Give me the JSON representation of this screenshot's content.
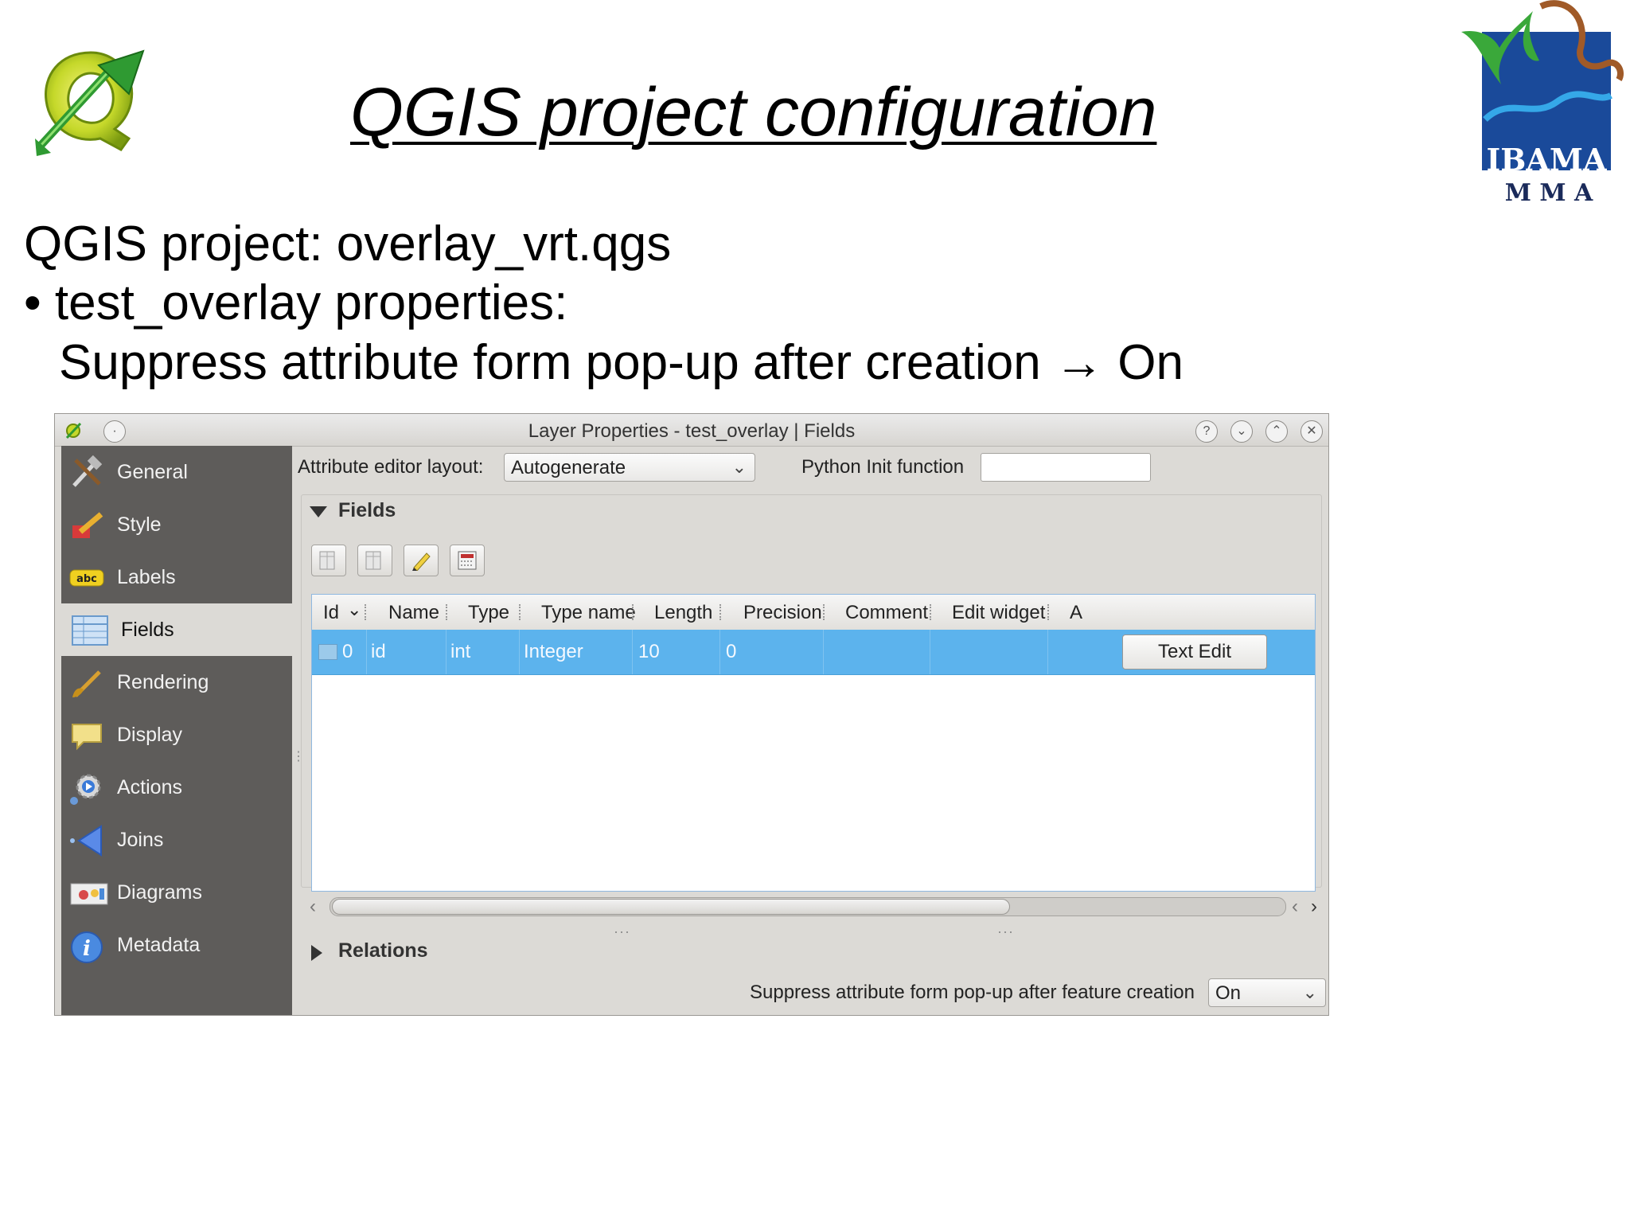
{
  "slide": {
    "title": "QGIS project configuration",
    "line1": "QGIS project: overlay_vrt.qgs",
    "line2": "• test_overlay properties:",
    "line3": "Suppress attribute form pop-up after creation → On",
    "ibama_logo_text": "IBAMA",
    "ibama_logo_subtext": "M M A"
  },
  "window": {
    "title": "Layer Properties - test_overlay | Fields",
    "buttons": {
      "help": "?",
      "minimize": "⌄",
      "maximize": "⌃",
      "close": "✕"
    }
  },
  "sidebar": {
    "items": [
      {
        "label": "General",
        "icon": "tools-icon"
      },
      {
        "label": "Style",
        "icon": "paint-brush-icon"
      },
      {
        "label": "Labels",
        "icon": "abc-label-icon"
      },
      {
        "label": "Fields",
        "icon": "table-icon",
        "selected": true
      },
      {
        "label": "Rendering",
        "icon": "brush-icon"
      },
      {
        "label": "Display",
        "icon": "speech-bubble-icon"
      },
      {
        "label": "Actions",
        "icon": "gear-icon"
      },
      {
        "label": "Joins",
        "icon": "join-icon"
      },
      {
        "label": "Diagrams",
        "icon": "diagram-icon"
      },
      {
        "label": "Metadata",
        "icon": "info-icon"
      }
    ]
  },
  "main": {
    "attr_editor_label": "Attribute editor layout:",
    "attr_editor_value": "Autogenerate",
    "python_init_label": "Python Init function",
    "python_init_value": "",
    "fields_heading": "Fields",
    "relations_heading": "Relations",
    "suppress_label": "Suppress attribute form pop-up after feature creation",
    "suppress_value": "On"
  },
  "table": {
    "columns": [
      "Id",
      "Name",
      "Type",
      "Type name",
      "Length",
      "Precision",
      "Comment",
      "Edit widget",
      "A"
    ],
    "rows": [
      {
        "id": "0",
        "name": "id",
        "type": "int",
        "type_name": "Integer",
        "length": "10",
        "precision": "0",
        "comment": "",
        "edit_widget": "Text Edit"
      }
    ]
  },
  "colors": {
    "sidebar_bg": "#5e5c5a",
    "selected_row": "#5cb3ed",
    "window_bg": "#dcdad6"
  }
}
